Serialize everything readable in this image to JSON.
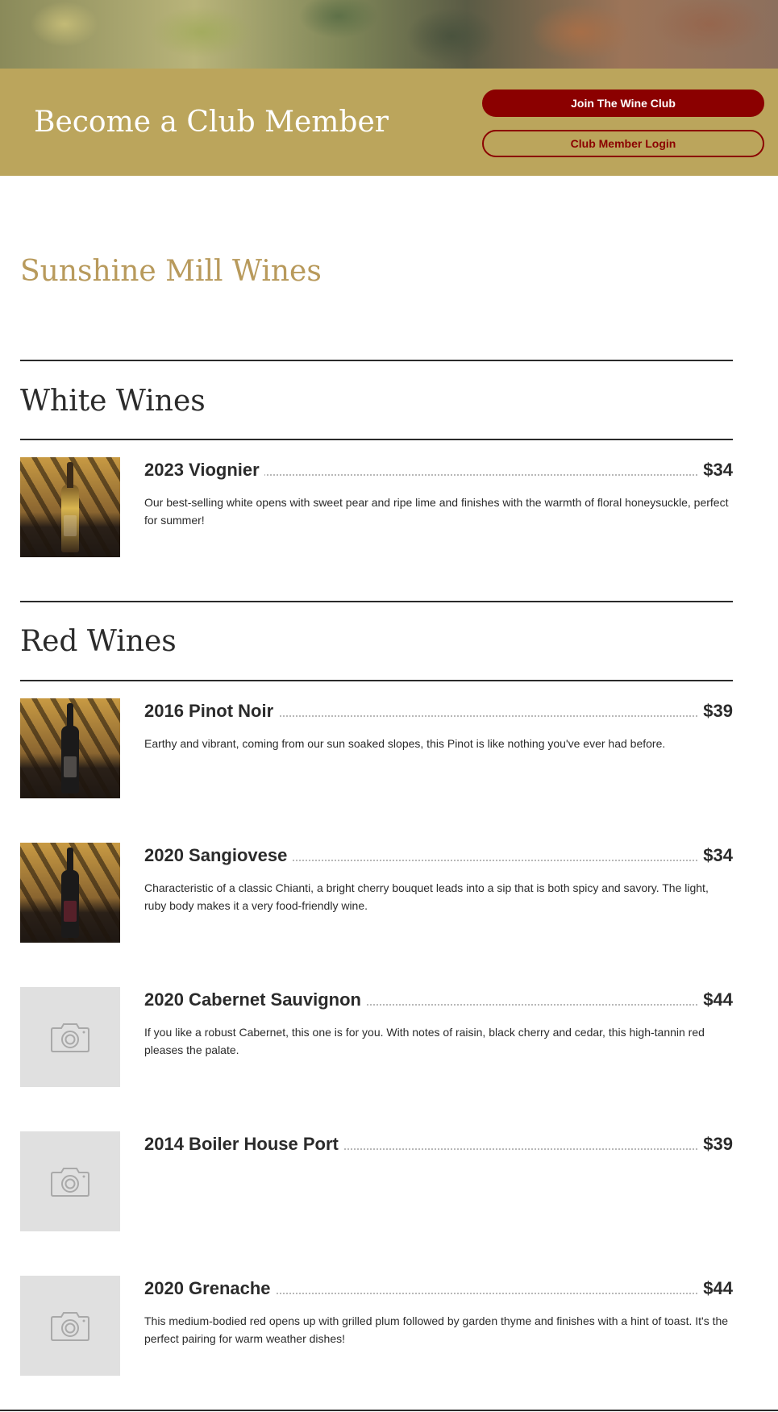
{
  "club_banner": {
    "title": "Become a Club Member",
    "join_button": "Join The Wine Club",
    "login_button": "Club Member Login"
  },
  "brand": {
    "title": "Sunshine Mill Wines"
  },
  "sections": [
    {
      "title": "White Wines",
      "items": [
        {
          "name": "2023 Viognier",
          "price": "$34",
          "description": "Our best-selling white opens with sweet pear and ripe lime and finishes with the warmth of floral honeysuckle, perfect for summer!",
          "image": "wine-bottle-photo"
        }
      ]
    },
    {
      "title": "Red Wines",
      "items": [
        {
          "name": "2016 Pinot Noir",
          "price": "$39",
          "description": "Earthy and vibrant, coming from our sun soaked slopes, this Pinot is like nothing you've ever had before.",
          "image": "wine-bottle-photo"
        },
        {
          "name": "2020 Sangiovese",
          "price": "$34",
          "description": "Characteristic of a classic Chianti, a bright cherry bouquet leads into a sip that is both spicy and savory. The light, ruby body makes it a very food-friendly wine.",
          "image": "wine-bottle-photo"
        },
        {
          "name": "2020 Cabernet Sauvignon",
          "price": "$44",
          "description": "If you like a robust Cabernet, this one is for you. With notes of raisin, black cherry and cedar, this high-tannin red pleases the palate.",
          "image": "camera-icon"
        },
        {
          "name": "2014 Boiler House Port",
          "price": "$39",
          "description": "",
          "image": "camera-icon"
        },
        {
          "name": "2020 Grenache",
          "price": "$44",
          "description": "This medium-bodied red opens up with grilled plum followed by garden thyme and finishes with a hint of toast. It's the perfect pairing for warm weather dishes!",
          "image": "camera-icon"
        }
      ]
    }
  ],
  "colors": {
    "banner_gold": "#bba55c",
    "brand_tan": "#b89a5c",
    "button_red": "#8b0000",
    "text_dark": "#2b2b2b",
    "placeholder_gray": "#e0e0e0"
  }
}
